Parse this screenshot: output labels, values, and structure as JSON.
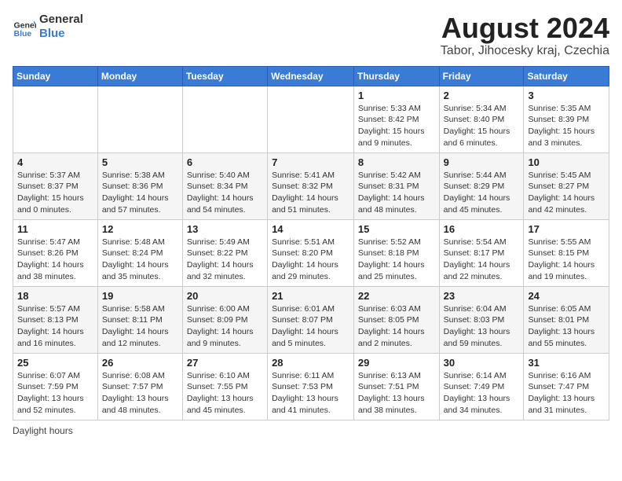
{
  "header": {
    "logo_general": "General",
    "logo_blue": "Blue",
    "title": "August 2024",
    "subtitle": "Tabor, Jihocesky kraj, Czechia"
  },
  "calendar": {
    "days_of_week": [
      "Sunday",
      "Monday",
      "Tuesday",
      "Wednesday",
      "Thursday",
      "Friday",
      "Saturday"
    ],
    "weeks": [
      [
        {
          "day": "",
          "info": ""
        },
        {
          "day": "",
          "info": ""
        },
        {
          "day": "",
          "info": ""
        },
        {
          "day": "",
          "info": ""
        },
        {
          "day": "1",
          "info": "Sunrise: 5:33 AM\nSunset: 8:42 PM\nDaylight: 15 hours\nand 9 minutes."
        },
        {
          "day": "2",
          "info": "Sunrise: 5:34 AM\nSunset: 8:40 PM\nDaylight: 15 hours\nand 6 minutes."
        },
        {
          "day": "3",
          "info": "Sunrise: 5:35 AM\nSunset: 8:39 PM\nDaylight: 15 hours\nand 3 minutes."
        }
      ],
      [
        {
          "day": "4",
          "info": "Sunrise: 5:37 AM\nSunset: 8:37 PM\nDaylight: 15 hours\nand 0 minutes."
        },
        {
          "day": "5",
          "info": "Sunrise: 5:38 AM\nSunset: 8:36 PM\nDaylight: 14 hours\nand 57 minutes."
        },
        {
          "day": "6",
          "info": "Sunrise: 5:40 AM\nSunset: 8:34 PM\nDaylight: 14 hours\nand 54 minutes."
        },
        {
          "day": "7",
          "info": "Sunrise: 5:41 AM\nSunset: 8:32 PM\nDaylight: 14 hours\nand 51 minutes."
        },
        {
          "day": "8",
          "info": "Sunrise: 5:42 AM\nSunset: 8:31 PM\nDaylight: 14 hours\nand 48 minutes."
        },
        {
          "day": "9",
          "info": "Sunrise: 5:44 AM\nSunset: 8:29 PM\nDaylight: 14 hours\nand 45 minutes."
        },
        {
          "day": "10",
          "info": "Sunrise: 5:45 AM\nSunset: 8:27 PM\nDaylight: 14 hours\nand 42 minutes."
        }
      ],
      [
        {
          "day": "11",
          "info": "Sunrise: 5:47 AM\nSunset: 8:26 PM\nDaylight: 14 hours\nand 38 minutes."
        },
        {
          "day": "12",
          "info": "Sunrise: 5:48 AM\nSunset: 8:24 PM\nDaylight: 14 hours\nand 35 minutes."
        },
        {
          "day": "13",
          "info": "Sunrise: 5:49 AM\nSunset: 8:22 PM\nDaylight: 14 hours\nand 32 minutes."
        },
        {
          "day": "14",
          "info": "Sunrise: 5:51 AM\nSunset: 8:20 PM\nDaylight: 14 hours\nand 29 minutes."
        },
        {
          "day": "15",
          "info": "Sunrise: 5:52 AM\nSunset: 8:18 PM\nDaylight: 14 hours\nand 25 minutes."
        },
        {
          "day": "16",
          "info": "Sunrise: 5:54 AM\nSunset: 8:17 PM\nDaylight: 14 hours\nand 22 minutes."
        },
        {
          "day": "17",
          "info": "Sunrise: 5:55 AM\nSunset: 8:15 PM\nDaylight: 14 hours\nand 19 minutes."
        }
      ],
      [
        {
          "day": "18",
          "info": "Sunrise: 5:57 AM\nSunset: 8:13 PM\nDaylight: 14 hours\nand 16 minutes."
        },
        {
          "day": "19",
          "info": "Sunrise: 5:58 AM\nSunset: 8:11 PM\nDaylight: 14 hours\nand 12 minutes."
        },
        {
          "day": "20",
          "info": "Sunrise: 6:00 AM\nSunset: 8:09 PM\nDaylight: 14 hours\nand 9 minutes."
        },
        {
          "day": "21",
          "info": "Sunrise: 6:01 AM\nSunset: 8:07 PM\nDaylight: 14 hours\nand 5 minutes."
        },
        {
          "day": "22",
          "info": "Sunrise: 6:03 AM\nSunset: 8:05 PM\nDaylight: 14 hours\nand 2 minutes."
        },
        {
          "day": "23",
          "info": "Sunrise: 6:04 AM\nSunset: 8:03 PM\nDaylight: 13 hours\nand 59 minutes."
        },
        {
          "day": "24",
          "info": "Sunrise: 6:05 AM\nSunset: 8:01 PM\nDaylight: 13 hours\nand 55 minutes."
        }
      ],
      [
        {
          "day": "25",
          "info": "Sunrise: 6:07 AM\nSunset: 7:59 PM\nDaylight: 13 hours\nand 52 minutes."
        },
        {
          "day": "26",
          "info": "Sunrise: 6:08 AM\nSunset: 7:57 PM\nDaylight: 13 hours\nand 48 minutes."
        },
        {
          "day": "27",
          "info": "Sunrise: 6:10 AM\nSunset: 7:55 PM\nDaylight: 13 hours\nand 45 minutes."
        },
        {
          "day": "28",
          "info": "Sunrise: 6:11 AM\nSunset: 7:53 PM\nDaylight: 13 hours\nand 41 minutes."
        },
        {
          "day": "29",
          "info": "Sunrise: 6:13 AM\nSunset: 7:51 PM\nDaylight: 13 hours\nand 38 minutes."
        },
        {
          "day": "30",
          "info": "Sunrise: 6:14 AM\nSunset: 7:49 PM\nDaylight: 13 hours\nand 34 minutes."
        },
        {
          "day": "31",
          "info": "Sunrise: 6:16 AM\nSunset: 7:47 PM\nDaylight: 13 hours\nand 31 minutes."
        }
      ]
    ]
  },
  "footer": {
    "note": "Daylight hours"
  }
}
